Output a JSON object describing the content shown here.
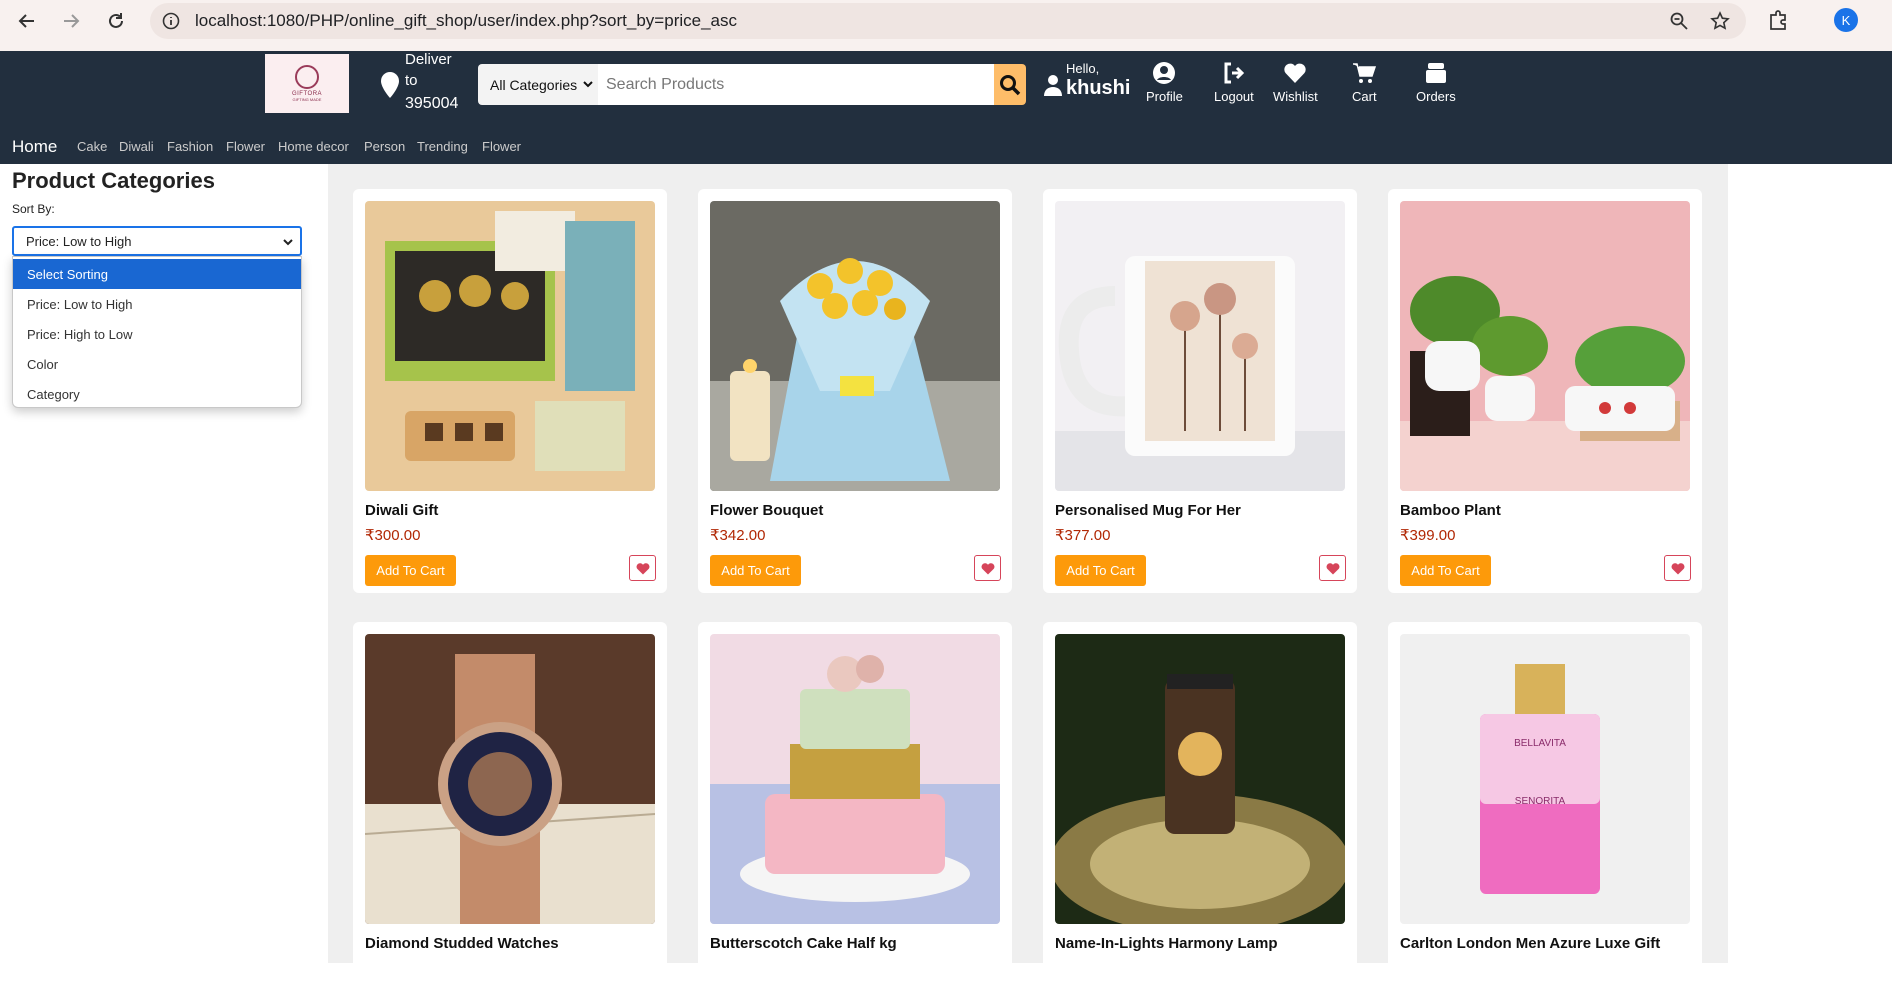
{
  "browser": {
    "url": "localhost:1080/PHP/online_gift_shop/user/index.php?sort_by=price_asc",
    "avatar_letter": "K"
  },
  "header": {
    "logo_text": "GIFTORA",
    "logo_sub": "GIFTING MADE",
    "deliver_line1": "Deliver",
    "deliver_line2": "to",
    "deliver_pin": "395004",
    "category_select": "All Categories",
    "search_placeholder": "Search Products",
    "hello": "Hello,",
    "username": "khushi",
    "nav": [
      {
        "label": "Profile",
        "icon": "profile-icon"
      },
      {
        "label": "Logout",
        "icon": "logout-icon"
      },
      {
        "label": "Wishlist",
        "icon": "heart-icon"
      },
      {
        "label": "Cart",
        "icon": "cart-icon"
      },
      {
        "label": "Orders",
        "icon": "orders-icon"
      }
    ]
  },
  "catnav": {
    "home": "Home",
    "items": [
      "Cake",
      "Diwali",
      "Fashion",
      "Flower",
      "Home decor",
      "Person",
      "Trending",
      "Flower"
    ]
  },
  "sidebar": {
    "title": "Product Categories",
    "sort_label": "Sort By:",
    "sort_value": "Price: Low to High",
    "options": [
      "Select Sorting",
      "Price: Low to High",
      "Price: High to Low",
      "Color",
      "Category"
    ],
    "highlighted_option": "Select Sorting"
  },
  "products": [
    {
      "name": "Diwali Gift",
      "price": "₹300.00",
      "button": "Add To Cart"
    },
    {
      "name": "Flower Bouquet",
      "price": "₹342.00",
      "button": "Add To Cart"
    },
    {
      "name": "Personalised Mug For Her",
      "price": "₹377.00",
      "button": "Add To Cart"
    },
    {
      "name": "Bamboo Plant",
      "price": "₹399.00",
      "button": "Add To Cart"
    },
    {
      "name": "Diamond Studded Watches",
      "price": "",
      "button": ""
    },
    {
      "name": "Butterscotch Cake Half kg",
      "price": "",
      "button": ""
    },
    {
      "name": "Name-In-Lights Harmony Lamp",
      "price": "",
      "button": ""
    },
    {
      "name": "Carlton London Men Azure Luxe Gift",
      "price": "",
      "button": ""
    }
  ],
  "perfume_label": "BELLAVITA",
  "perfume_sub": "SENORITA",
  "colors": {
    "header": "#222f3e",
    "accent": "#fd9a0a",
    "price": "#b12704",
    "search_btn": "#febd69"
  }
}
